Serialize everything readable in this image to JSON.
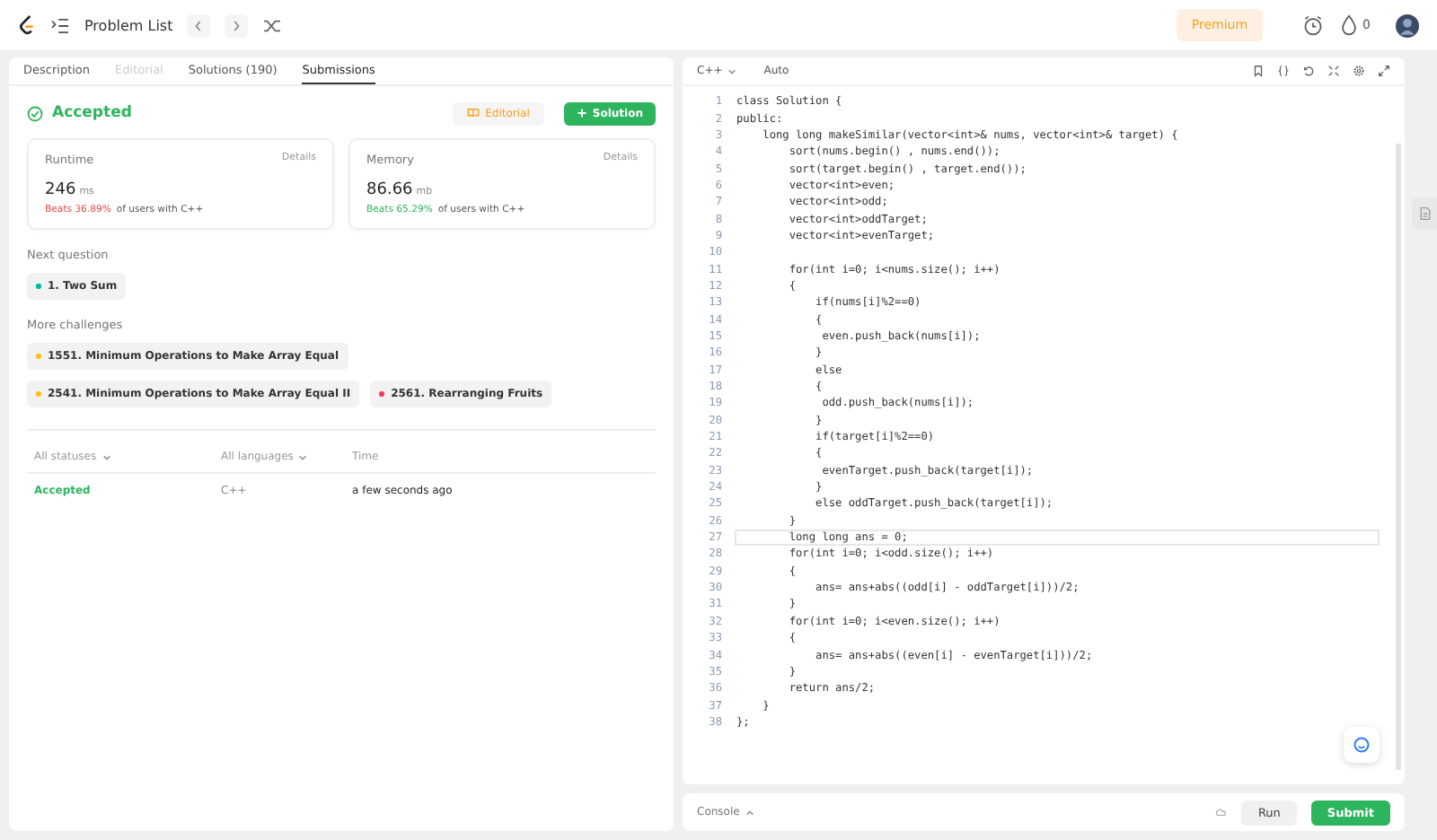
{
  "topbar": {
    "title": "Problem List",
    "premium": "Premium",
    "streak": "0"
  },
  "tabs": [
    {
      "label": "Description",
      "selected": false,
      "disabled": false
    },
    {
      "label": "Editorial",
      "selected": false,
      "disabled": true
    },
    {
      "label": "Solutions (190)",
      "selected": false,
      "disabled": false
    },
    {
      "label": "Submissions",
      "selected": true,
      "disabled": false
    }
  ],
  "result": {
    "status": "Accepted",
    "editorial_button": "Editorial",
    "solution_button": "Solution"
  },
  "stats": [
    {
      "label": "Runtime",
      "details": "Details",
      "value": "246",
      "unit": "ms",
      "beats": "Beats 36.89%",
      "kind": "low",
      "suffix": "of users with C++"
    },
    {
      "label": "Memory",
      "details": "Details",
      "value": "86.66",
      "unit": "mb",
      "beats": "Beats 65.29%",
      "kind": "high",
      "suffix": "of users with C++"
    }
  ],
  "next_question": {
    "heading": "Next question",
    "items": [
      {
        "title": "1. Two Sum",
        "color": "#00b8a3"
      }
    ]
  },
  "more_challenges": {
    "heading": "More challenges",
    "items": [
      {
        "title": "1551. Minimum Operations to Make Array Equal",
        "color": "#ffc01e"
      },
      {
        "title": "2541. Minimum Operations to Make Array Equal II",
        "color": "#ffc01e"
      },
      {
        "title": "2561. Rearranging Fruits",
        "color": "#ff375f"
      }
    ]
  },
  "submissions": {
    "columns": [
      "All statuses",
      "All languages",
      "Time"
    ],
    "rows": [
      {
        "status": "Accepted",
        "language": "C++",
        "time": "a few seconds ago"
      }
    ]
  },
  "editor": {
    "language": "C++",
    "mode": "Auto",
    "lines": [
      {
        "number": "1",
        "code": "class Solution {",
        "current": false
      },
      {
        "number": "2",
        "code": "public:",
        "current": false
      },
      {
        "number": "3",
        "code": "    long long makeSimilar(vector<int>& nums, vector<int>& target) {",
        "current": false
      },
      {
        "number": "4",
        "code": "        sort(nums.begin() , nums.end());",
        "current": false
      },
      {
        "number": "5",
        "code": "        sort(target.begin() , target.end());",
        "current": false
      },
      {
        "number": "6",
        "code": "        vector<int>even;",
        "current": false
      },
      {
        "number": "7",
        "code": "        vector<int>odd;",
        "current": false
      },
      {
        "number": "8",
        "code": "        vector<int>oddTarget;",
        "current": false
      },
      {
        "number": "9",
        "code": "        vector<int>evenTarget;",
        "current": false
      },
      {
        "number": "10",
        "current": false
      },
      {
        "number": "11",
        "code": "        for(int i=0; i<nums.size(); i++)",
        "current": false
      },
      {
        "number": "12",
        "code": "        {",
        "current": false
      },
      {
        "number": "13",
        "code": "            if(nums[i]%2==0)",
        "current": false
      },
      {
        "number": "14",
        "code": "            {",
        "current": false
      },
      {
        "number": "15",
        "code": "             even.push_back(nums[i]);",
        "current": false
      },
      {
        "number": "16",
        "code": "            }",
        "current": false
      },
      {
        "number": "17",
        "code": "            else",
        "current": false
      },
      {
        "number": "18",
        "code": "            {",
        "current": false
      },
      {
        "number": "19",
        "code": "             odd.push_back(nums[i]);",
        "current": false
      },
      {
        "number": "20",
        "code": "            }",
        "current": false
      },
      {
        "number": "21",
        "code": "            if(target[i]%2==0)",
        "current": false
      },
      {
        "number": "22",
        "code": "            {",
        "current": false
      },
      {
        "number": "23",
        "code": "             evenTarget.push_back(target[i]);",
        "current": false
      },
      {
        "number": "24",
        "code": "            }",
        "current": false
      },
      {
        "number": "25",
        "code": "            else oddTarget.push_back(target[i]);",
        "current": false
      },
      {
        "number": "26",
        "code": "        }",
        "current": false
      },
      {
        "number": "27",
        "code": "        long long ans = 0;",
        "current": true
      },
      {
        "number": "28",
        "code": "        for(int i=0; i<odd.size(); i++)",
        "current": false
      },
      {
        "number": "29",
        "code": "        {",
        "current": false
      },
      {
        "number": "30",
        "code": "            ans= ans+abs((odd[i] - oddTarget[i]))/2;",
        "current": false
      },
      {
        "number": "31",
        "code": "        }",
        "current": false
      },
      {
        "number": "32",
        "code": "        for(int i=0; i<even.size(); i++)",
        "current": false
      },
      {
        "number": "33",
        "code": "        {",
        "current": false
      },
      {
        "number": "34",
        "code": "            ans= ans+abs((even[i] - evenTarget[i]))/2;",
        "current": false
      },
      {
        "number": "35",
        "code": "        }",
        "current": false
      },
      {
        "number": "36",
        "code": "        return ans/2;",
        "current": false
      },
      {
        "number": "37",
        "code": "    }",
        "current": false
      },
      {
        "number": "38",
        "code": "};",
        "current": false
      }
    ]
  },
  "console": {
    "label": "Console",
    "run": "Run",
    "submit": "Submit"
  }
}
